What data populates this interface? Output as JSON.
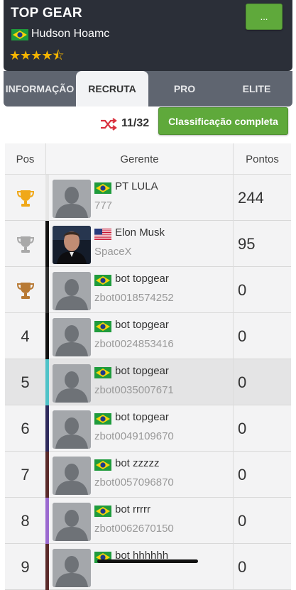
{
  "header": {
    "title": "TOP GEAR",
    "manager_name": "Hudson Hoamc",
    "stars": "★★★★⯪",
    "menu_label": "...",
    "flag_icon": "brazil-flag-icon"
  },
  "tabs": [
    {
      "label": "INFORMAÇÃO",
      "active": false
    },
    {
      "label": "RECRUTA",
      "active": true
    },
    {
      "label": "PRO",
      "active": false
    },
    {
      "label": "ELITE",
      "active": false
    }
  ],
  "toolbar": {
    "count": "11/32",
    "full_button": "Classificação completa",
    "shuffle_icon": "shuffle-icon"
  },
  "table": {
    "headers": {
      "pos": "Pos",
      "manager": "Gerente",
      "points": "Pontos"
    },
    "rows": [
      {
        "pos": "",
        "trophy": "gold",
        "name": "PT LULA",
        "team": "777",
        "points": "244",
        "flag": "brazil",
        "stripe": "#e6e6e6",
        "photo": false
      },
      {
        "pos": "",
        "trophy": "silver",
        "name": "Elon Musk",
        "team": "SpaceX",
        "points": "95",
        "flag": "usa",
        "stripe": "#111111",
        "photo": true
      },
      {
        "pos": "",
        "trophy": "bronze",
        "name": "bot topgear",
        "team": "zbot0018574252",
        "points": "0",
        "flag": "brazil",
        "stripe": "#2b2b2b",
        "photo": false
      },
      {
        "pos": "4",
        "trophy": "",
        "name": "bot topgear",
        "team": "zbot0024853416",
        "points": "0",
        "flag": "brazil",
        "stripe": "#111111",
        "photo": false
      },
      {
        "pos": "5",
        "trophy": "",
        "name": "bot topgear",
        "team": "zbot0035007671",
        "points": "0",
        "flag": "brazil",
        "stripe": "#4fc3c8",
        "photo": false
      },
      {
        "pos": "6",
        "trophy": "",
        "name": "bot topgear",
        "team": "zbot0049109670",
        "points": "0",
        "flag": "brazil",
        "stripe": "#2e2a5c",
        "photo": false
      },
      {
        "pos": "7",
        "trophy": "",
        "name": "bot zzzzz",
        "team": "zbot0057096870",
        "points": "0",
        "flag": "brazil",
        "stripe": "#5a2a2a",
        "photo": false
      },
      {
        "pos": "8",
        "trophy": "",
        "name": "bot rrrrr",
        "team": "zbot0062670150",
        "points": "0",
        "flag": "brazil",
        "stripe": "#9b6ad0",
        "photo": false
      },
      {
        "pos": "9",
        "trophy": "",
        "name": "bot hhhhhh",
        "team": "",
        "points": "0",
        "flag": "brazil",
        "stripe": "#5a2a2a",
        "photo": false
      }
    ]
  },
  "colors": {
    "accent_green": "#5fa93b",
    "header_dark": "#2b2f38",
    "gold": "#f0a818",
    "silver": "#a9a9a9",
    "bronze": "#b87a35"
  }
}
